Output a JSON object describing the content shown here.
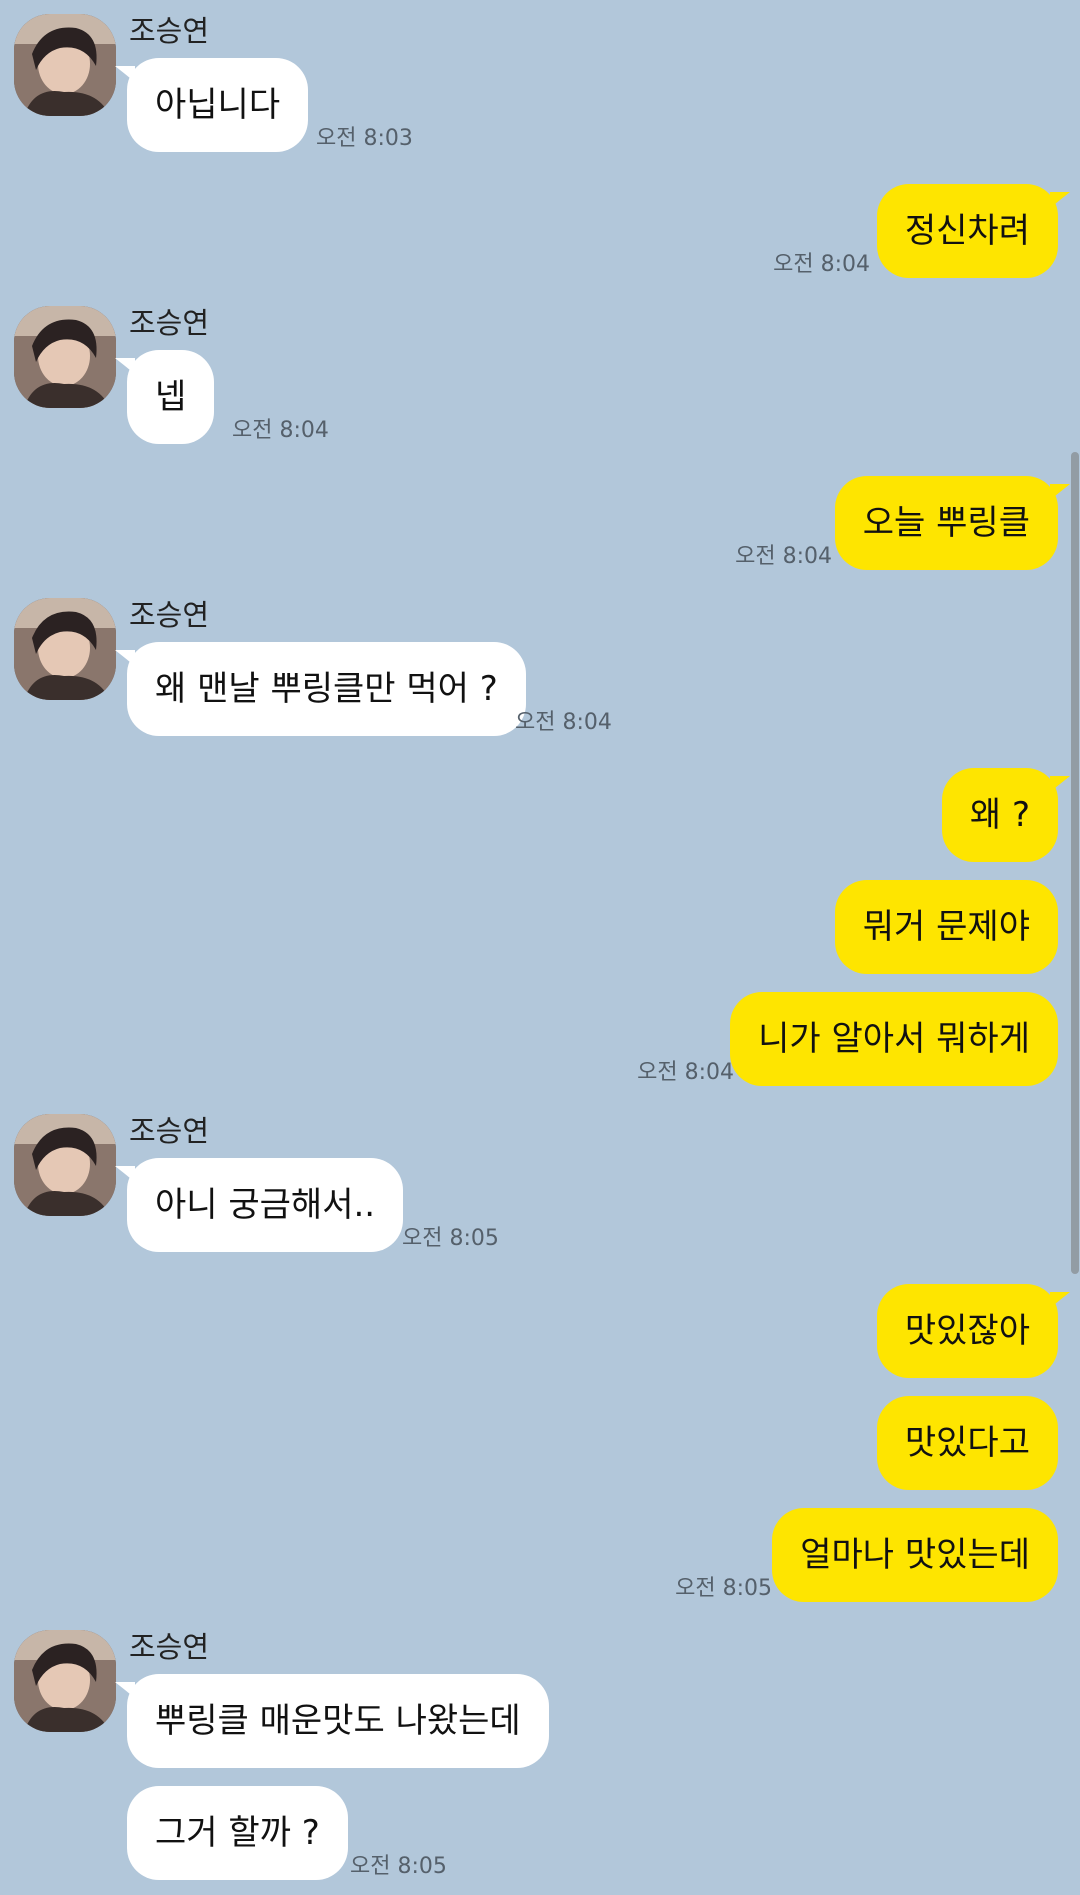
{
  "chat": {
    "partner_name": "조승연",
    "messages": [
      {
        "side": "in",
        "show_name": true,
        "text": "아닙니다",
        "time": "오전 8:03"
      },
      {
        "side": "out",
        "text": "정신차려",
        "time": "오전 8:04"
      },
      {
        "side": "in",
        "show_name": true,
        "text": "넵",
        "time": "오전 8:04"
      },
      {
        "side": "out",
        "text": "오늘 뿌링클",
        "time": "오전 8:04"
      },
      {
        "side": "in",
        "show_name": true,
        "text": "왜 맨날 뿌링클만 먹어 ?",
        "time": "오전 8:04"
      },
      {
        "side": "out",
        "text": "왜 ?",
        "time": ""
      },
      {
        "side": "out",
        "text": "뭐거 문제야",
        "time": ""
      },
      {
        "side": "out",
        "text": "니가 알아서 뭐하게",
        "time": "오전 8:04"
      },
      {
        "side": "in",
        "show_name": true,
        "text": "아니 궁금해서..",
        "time": "오전 8:05"
      },
      {
        "side": "out",
        "text": "맛있잖아",
        "time": ""
      },
      {
        "side": "out",
        "text": "맛있다고",
        "time": ""
      },
      {
        "side": "out",
        "text": "얼마나 맛있는데",
        "time": "오전 8:05"
      },
      {
        "side": "in",
        "show_name": true,
        "text": "뿌링클 매운맛도 나왔는데",
        "time": ""
      },
      {
        "side": "in",
        "show_name": false,
        "text": "그거 할까 ?",
        "time": "오전 8:05"
      }
    ]
  },
  "colors": {
    "background": "#b2c7da",
    "incoming_bubble": "#ffffff",
    "outgoing_bubble": "#fee500"
  },
  "icons": {
    "avatar": "profile-photo"
  }
}
